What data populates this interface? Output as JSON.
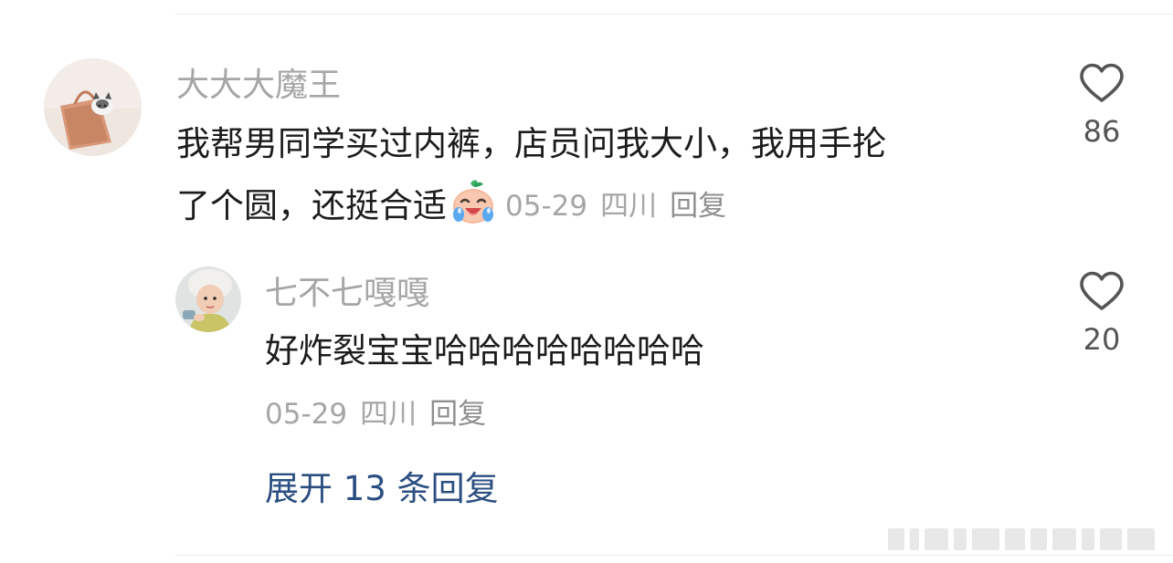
{
  "comment": {
    "username": "大大大魔王",
    "text_line1": "我帮男同学买过内裤，店员问我大小，我用手抡",
    "text_line2": "了个圆，还挺合适",
    "emoji": "laughing-crying-face-emoji",
    "date": "05-29",
    "location": "四川",
    "reply_label": "回复",
    "like_count": "86"
  },
  "reply": {
    "username": "七不七嘎嘎",
    "text": "好炸裂宝宝哈哈哈哈哈哈哈哈",
    "date": "05-29",
    "location": "四川",
    "reply_label": "回复",
    "like_count": "20"
  },
  "expand_label": "展开 13 条回复",
  "colors": {
    "username": "#a6a6a6",
    "text": "#1c1c1c",
    "meta": "#a6a6a6",
    "link": "#2c4f82",
    "like_count": "#555555"
  }
}
